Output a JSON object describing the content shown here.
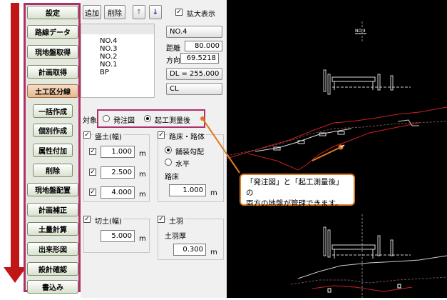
{
  "menu": {
    "items": [
      {
        "label": "設定",
        "type": "main"
      },
      {
        "label": "路線データ",
        "type": "main"
      },
      {
        "label": "現地盤取得",
        "type": "main"
      },
      {
        "label": "計画取得",
        "type": "main"
      },
      {
        "label": "土工区分線",
        "type": "accent"
      },
      {
        "label": "一括作成",
        "type": "sub"
      },
      {
        "label": "個別作成",
        "type": "sub"
      },
      {
        "label": "属性付加",
        "type": "sub"
      },
      {
        "label": "削除",
        "type": "sub"
      },
      {
        "label": "現地盤配置",
        "type": "main"
      },
      {
        "label": "計画補正",
        "type": "main"
      },
      {
        "label": "土量計算",
        "type": "main"
      },
      {
        "label": "出来形図",
        "type": "main"
      },
      {
        "label": "設計確認",
        "type": "main"
      },
      {
        "label": "書込み",
        "type": "main"
      }
    ]
  },
  "toolbar": {
    "add_label": "追加",
    "delete_label": "削除",
    "up_icon": "↑",
    "down_icon": "↓"
  },
  "zoom": {
    "label": "拡大表示",
    "checked": true
  },
  "station_list": [
    "NO.4",
    "NO.3",
    "NO.2",
    "NO.1",
    "BP"
  ],
  "station_info": {
    "current": "NO.4",
    "distance_label": "距離",
    "distance_value": "80.000",
    "direction_label": "方向",
    "direction_value": "69.5218",
    "dl_label": "DL = 255.000",
    "cl_label": "CL"
  },
  "target": {
    "label": "対象",
    "option_a": "発注図",
    "option_b": "起工測量後",
    "selected": "起工測量後"
  },
  "fill": {
    "title": "盛土(幅)",
    "rows": [
      {
        "value": "1.000",
        "unit": "m"
      },
      {
        "value": "2.500",
        "unit": "m"
      },
      {
        "value": "4.000",
        "unit": "m"
      }
    ]
  },
  "roadbed": {
    "title": "路床・路体",
    "option_a": "舗装勾配",
    "option_b": "水平",
    "selected": "舗装勾配",
    "subgrade_label": "路床",
    "subgrade_value": "1.000",
    "unit": "m"
  },
  "cut": {
    "title": "切土(幅)",
    "value": "5.000",
    "unit": "m"
  },
  "soil_cover": {
    "title": "土羽",
    "thickness_label": "土羽厚",
    "thickness_value": "0.300",
    "unit": "m"
  },
  "cad": {
    "section_label_top": "NO.4"
  },
  "callout": {
    "line1": "「発注図」と「起工測量後」の",
    "line2": "両方の地盤が管理できます。"
  },
  "colors": {
    "menu_frame": "#b0306a",
    "arrow": "#c01616",
    "callout_border": "#e07a22",
    "terrain": "#cc2020",
    "highlight_box": "#b0306a"
  }
}
